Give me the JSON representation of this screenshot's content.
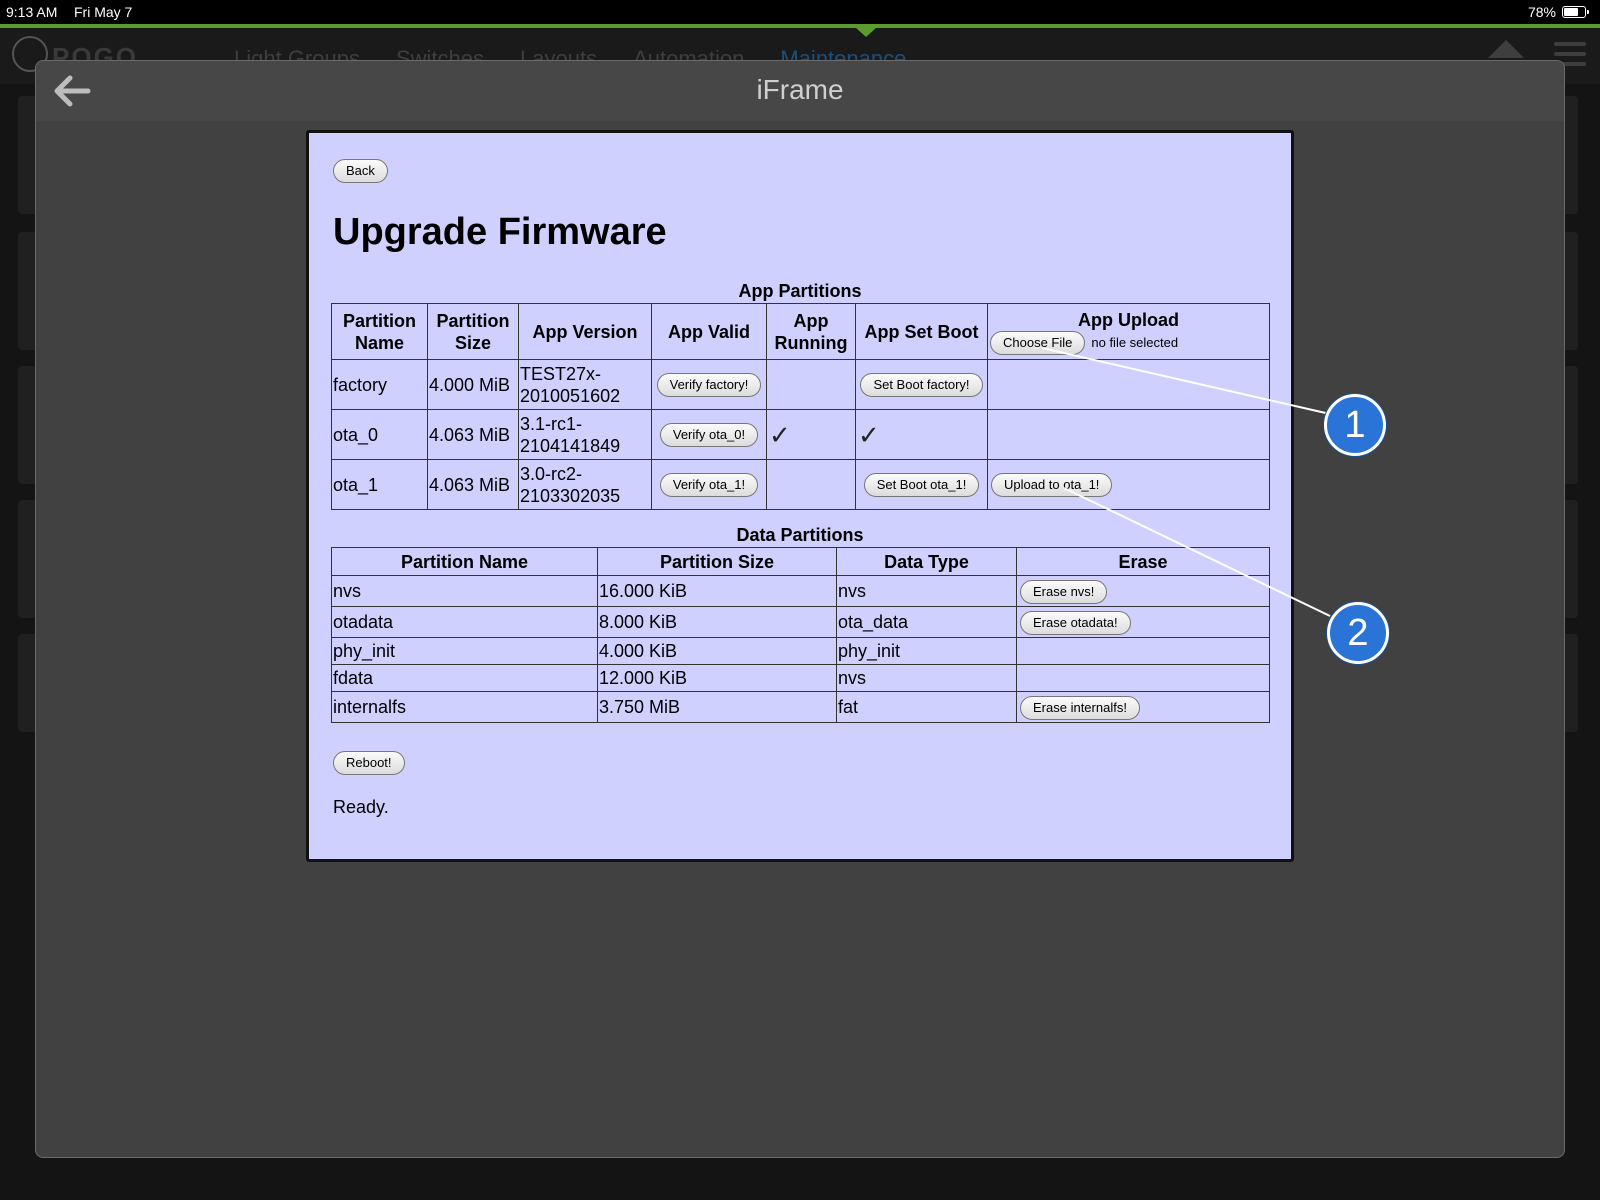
{
  "status_bar": {
    "time": "9:13 AM",
    "date": "Fri May 7",
    "battery": "78%"
  },
  "app": {
    "logo_text": "POGO",
    "nav": [
      "Light Groups",
      "Switches",
      "Layouts",
      "Automation",
      "Maintenance"
    ]
  },
  "modal": {
    "title": "iFrame"
  },
  "page": {
    "back_label": "Back",
    "title": "Upgrade Firmware",
    "app_partitions": {
      "caption": "App Partitions",
      "headers": [
        "Partition Name",
        "Partition Size",
        "App Version",
        "App Valid",
        "App Running",
        "App Set Boot",
        "App Upload"
      ],
      "choose_file_label": "Choose File",
      "no_file_text": "no file selected",
      "rows": [
        {
          "name": "factory",
          "size": "4.000 MiB",
          "version": "TEST27x-2010051602",
          "verify_label": "Verify factory!",
          "running": "",
          "set_boot_label": "Set Boot factory!",
          "set_boot_mark": "",
          "upload_label": ""
        },
        {
          "name": "ota_0",
          "size": "4.063 MiB",
          "version": "3.1-rc1-2104141849",
          "verify_label": "Verify ota_0!",
          "running": "✓",
          "set_boot_label": "",
          "set_boot_mark": "✓",
          "upload_label": ""
        },
        {
          "name": "ota_1",
          "size": "4.063 MiB",
          "version": "3.0-rc2-2103302035",
          "verify_label": "Verify ota_1!",
          "running": "",
          "set_boot_label": "Set Boot ota_1!",
          "set_boot_mark": "",
          "upload_label": "Upload to ota_1!"
        }
      ]
    },
    "data_partitions": {
      "caption": "Data Partitions",
      "headers": [
        "Partition Name",
        "Partition Size",
        "Data Type",
        "Erase"
      ],
      "rows": [
        {
          "name": "nvs",
          "size": "16.000 KiB",
          "type": "nvs",
          "erase_label": "Erase nvs!"
        },
        {
          "name": "otadata",
          "size": "8.000 KiB",
          "type": "ota_data",
          "erase_label": "Erase otadata!"
        },
        {
          "name": "phy_init",
          "size": "4.000 KiB",
          "type": "phy_init",
          "erase_label": ""
        },
        {
          "name": "fdata",
          "size": "12.000 KiB",
          "type": "nvs",
          "erase_label": ""
        },
        {
          "name": "internalfs",
          "size": "3.750 MiB",
          "type": "fat",
          "erase_label": "Erase internalfs!"
        }
      ]
    },
    "reboot_label": "Reboot!",
    "status_text": "Ready."
  },
  "callouts": [
    "1",
    "2"
  ],
  "colors": {
    "page_bg": "#d0d0ff",
    "accent_green": "#5c9b2d",
    "callout_blue": "#2a74d8",
    "active_nav": "#1d4f7a"
  }
}
